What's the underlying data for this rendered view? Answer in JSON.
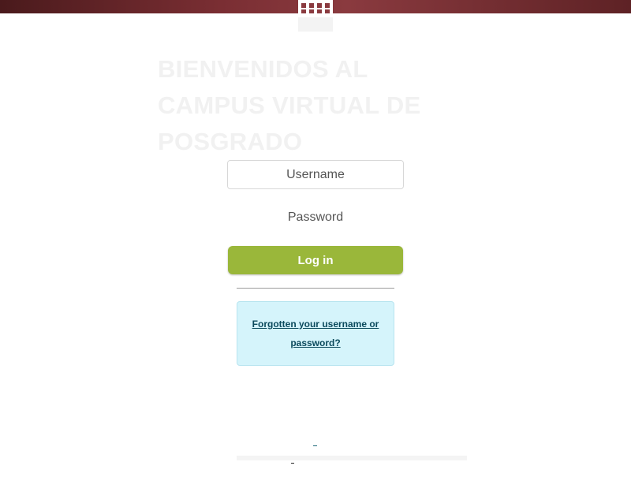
{
  "header": {
    "logo_icon": "building-icon",
    "banner_color": "#7a2e33"
  },
  "welcome": {
    "title": "BIENVENIDOS AL CAMPUS VIRTUAL DE POSGRADO"
  },
  "login": {
    "username_placeholder": "Username",
    "password_placeholder": "Password",
    "login_label": "Log in",
    "login_color": "#9ab73a"
  },
  "forgot": {
    "link_text": "Forgotten your username or password?",
    "box_color": "#d5f4fb"
  }
}
